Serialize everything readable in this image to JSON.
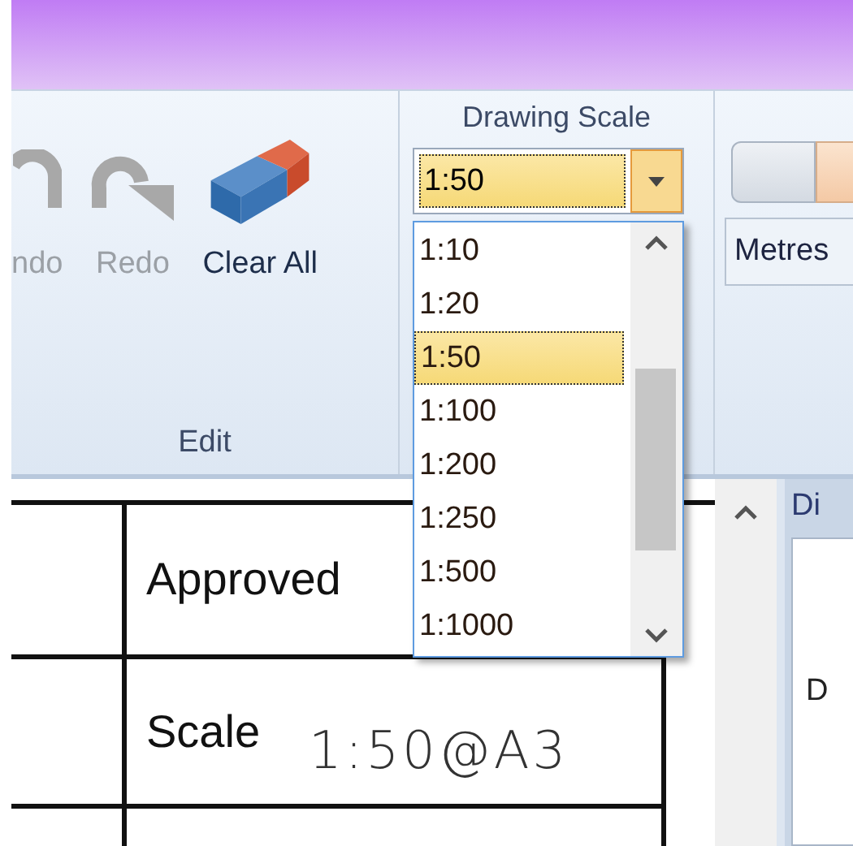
{
  "ribbon": {
    "edit_group": {
      "label": "Edit",
      "buttons": [
        {
          "kind": "undo",
          "label": "ndo",
          "disabled": true
        },
        {
          "kind": "redo",
          "label": "Redo",
          "disabled": true
        },
        {
          "kind": "clear",
          "label": "Clear All",
          "disabled": false
        }
      ]
    },
    "scale_group": {
      "label": "Drawing Scale",
      "value": "1:50",
      "expanded": true,
      "options": [
        {
          "label": "1:10",
          "selected": false
        },
        {
          "label": "1:20",
          "selected": false
        },
        {
          "label": "1:50",
          "selected": true
        },
        {
          "label": "1:100",
          "selected": false
        },
        {
          "label": "1:200",
          "selected": false
        },
        {
          "label": "1:250",
          "selected": false
        },
        {
          "label": "1:500",
          "selected": false
        },
        {
          "label": "1:1000",
          "selected": false
        }
      ]
    },
    "units_group": {
      "units": "Metres"
    }
  },
  "drawing": {
    "rows": [
      {
        "label": "Approved",
        "value": ""
      },
      {
        "label": "Scale",
        "value": "1:50@A3"
      }
    ]
  },
  "side_panel": {
    "title": "Di",
    "tab": "D"
  }
}
